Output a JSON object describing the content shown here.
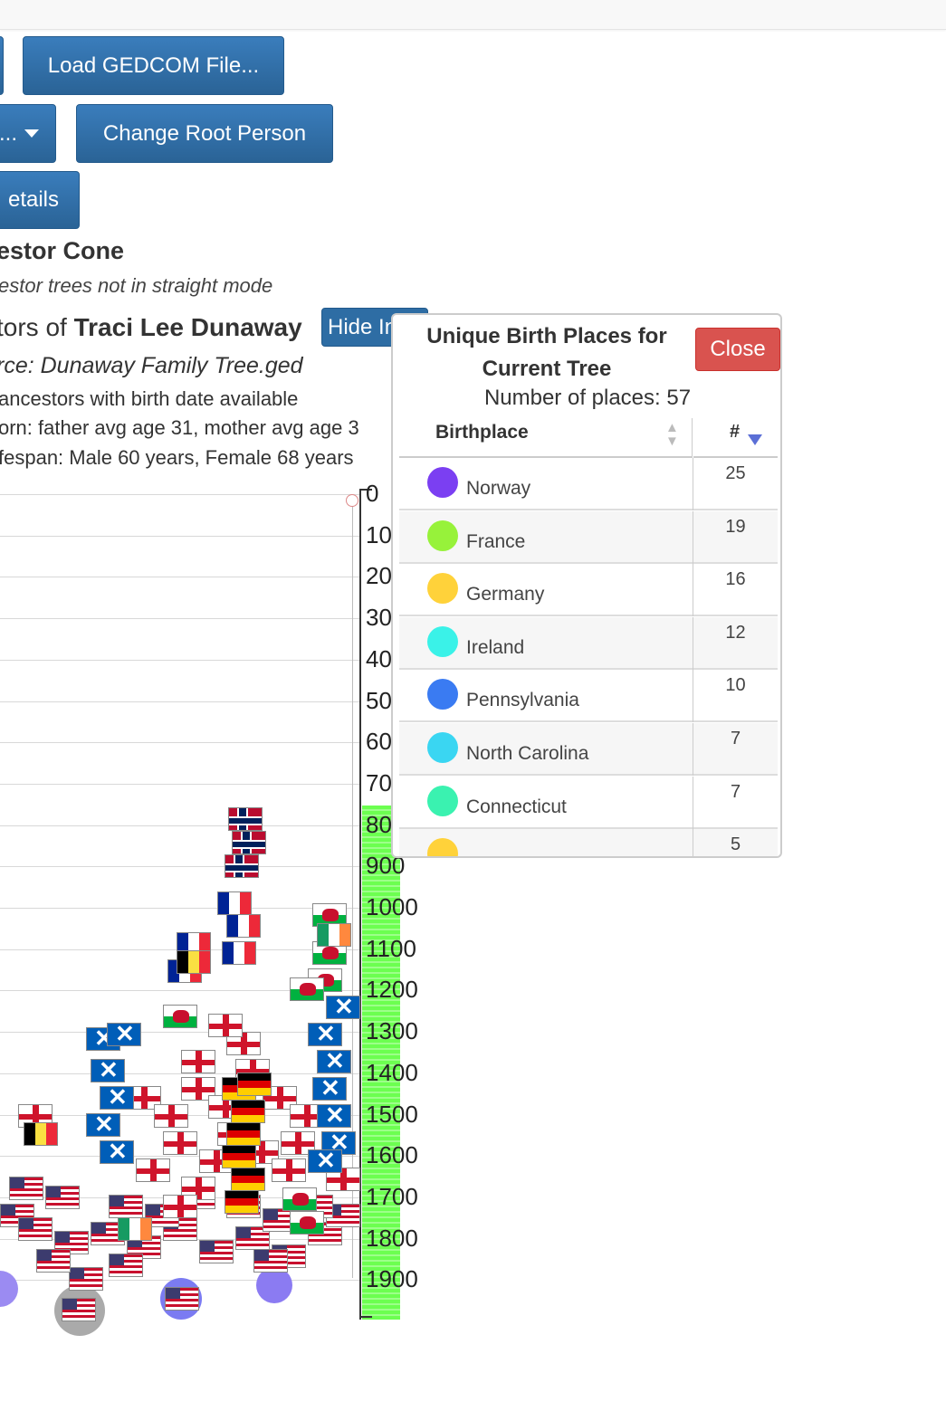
{
  "toolbar": {
    "load_gedcom": "Load GEDCOM File...",
    "change_root": "Change Root Person",
    "menu_dropdown": "...",
    "details": "etails"
  },
  "header": {
    "cone_title": "estor Cone",
    "cone_note": "estor trees not in straight mode",
    "ancestors_prefix": "tors of",
    "root_person": "Traci Lee Dunaway",
    "hide_info": "Hide Info",
    "source": "rce: Dunaway Family Tree.ged",
    "stat_birthdate": "ancestors with birth date available",
    "stat_born": "orn: father avg age 31, mother avg age 3",
    "stat_lifespan": "fespan: Male 60 years, Female 68 years"
  },
  "axis": {
    "ticks": [
      "0",
      "100",
      "200",
      "300",
      "400",
      "500",
      "600",
      "700",
      "800",
      "900",
      "1000",
      "1100",
      "1200",
      "1300",
      "1400",
      "1500",
      "1600",
      "1700",
      "1800",
      "1900"
    ]
  },
  "birthplaces_panel": {
    "title": "Unique Birth Places for Current Tree",
    "close": "Close",
    "count_text": "Number of places: 57",
    "col_place": "Birthplace",
    "col_count": "#",
    "rows": [
      {
        "place": "Norway",
        "count": "25",
        "color": "#7b3ff2"
      },
      {
        "place": "France",
        "count": "19",
        "color": "#97f23a"
      },
      {
        "place": "Germany",
        "count": "16",
        "color": "#ffd23a"
      },
      {
        "place": "Ireland",
        "count": "12",
        "color": "#3af2e8"
      },
      {
        "place": "Pennsylvania",
        "count": "10",
        "color": "#3a7bf2"
      },
      {
        "place": "North Carolina",
        "count": "7",
        "color": "#3ad6f2"
      },
      {
        "place": "Connecticut",
        "count": "7",
        "color": "#3af2b0"
      },
      {
        "place": "",
        "count": "5",
        "color": "#ffd23a"
      }
    ]
  },
  "colors": {
    "button_blue": "#2e6da4",
    "close_red": "#d9534f",
    "timeline_green": "#6cff50"
  }
}
